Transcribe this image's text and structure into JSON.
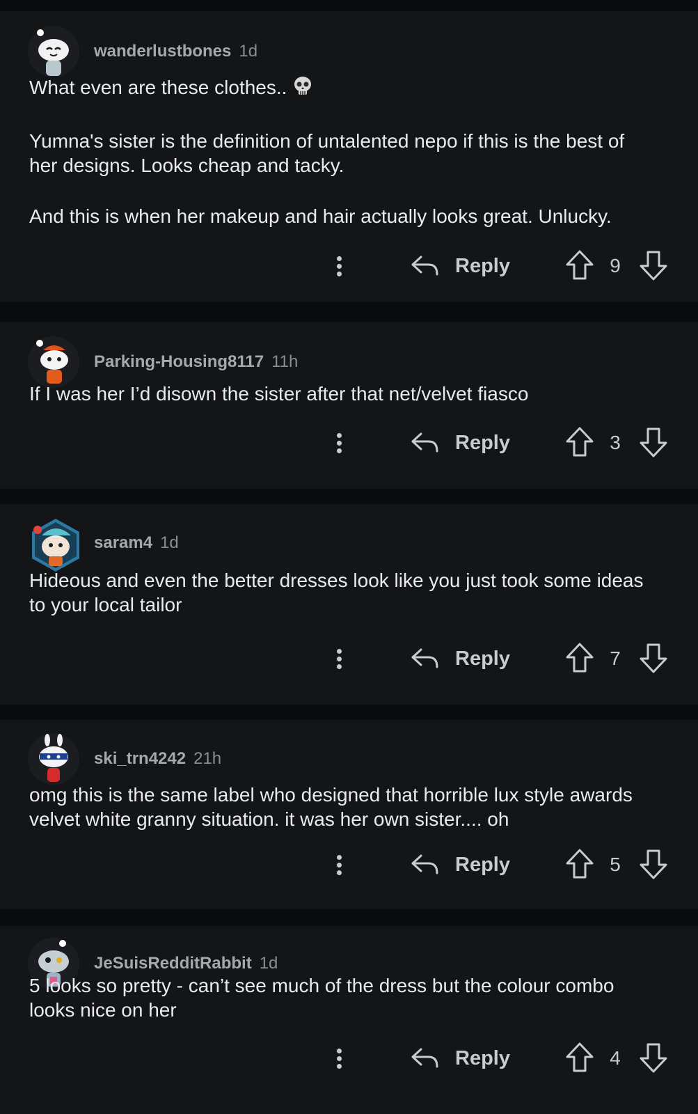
{
  "comments": [
    {
      "username": "wanderlustbones",
      "age": "1d",
      "paragraphs": [
        "What even are these clothes..",
        "Yumna's sister is the definition of untalented nepo if this is the best of her designs. Looks cheap and tacky.",
        "And this is when her makeup and hair actually looks great. Unlucky."
      ],
      "emoji": "skull-icon",
      "reply_label": "Reply",
      "score": "9"
    },
    {
      "username": "Parking-Housing8117",
      "age": "11h",
      "paragraphs": [
        "If I was her I’d disown the sister after that net/velvet fiasco"
      ],
      "reply_label": "Reply",
      "score": "3"
    },
    {
      "username": "saram4",
      "age": "1d",
      "paragraphs": [
        "Hideous and even the better dresses look like you just took some ideas to your local tailor"
      ],
      "reply_label": "Reply",
      "score": "7"
    },
    {
      "username": "ski_trn4242",
      "age": "21h",
      "paragraphs": [
        "omg this is the same label who designed that horrible lux style awards velvet white granny situation. it was her own sister.... oh"
      ],
      "reply_label": "Reply",
      "score": "5"
    },
    {
      "username": "JeSuisRedditRabbit",
      "age": "1d",
      "paragraphs": [
        "5 looks so pretty - can’t see much of the dress but the colour combo looks nice on her"
      ],
      "reply_label": "Reply",
      "score": "4"
    }
  ],
  "icons": {
    "more": "more-options-icon",
    "reply": "reply-arrow-icon",
    "upvote": "upvote-arrow-icon",
    "downvote": "downvote-arrow-icon"
  },
  "colors": {
    "background": "#0a0b0c",
    "card": "#141517",
    "text": "#e8eaec",
    "username": "#a5a9ae",
    "muted": "#8a8e93",
    "icon": "#c9cccf"
  }
}
